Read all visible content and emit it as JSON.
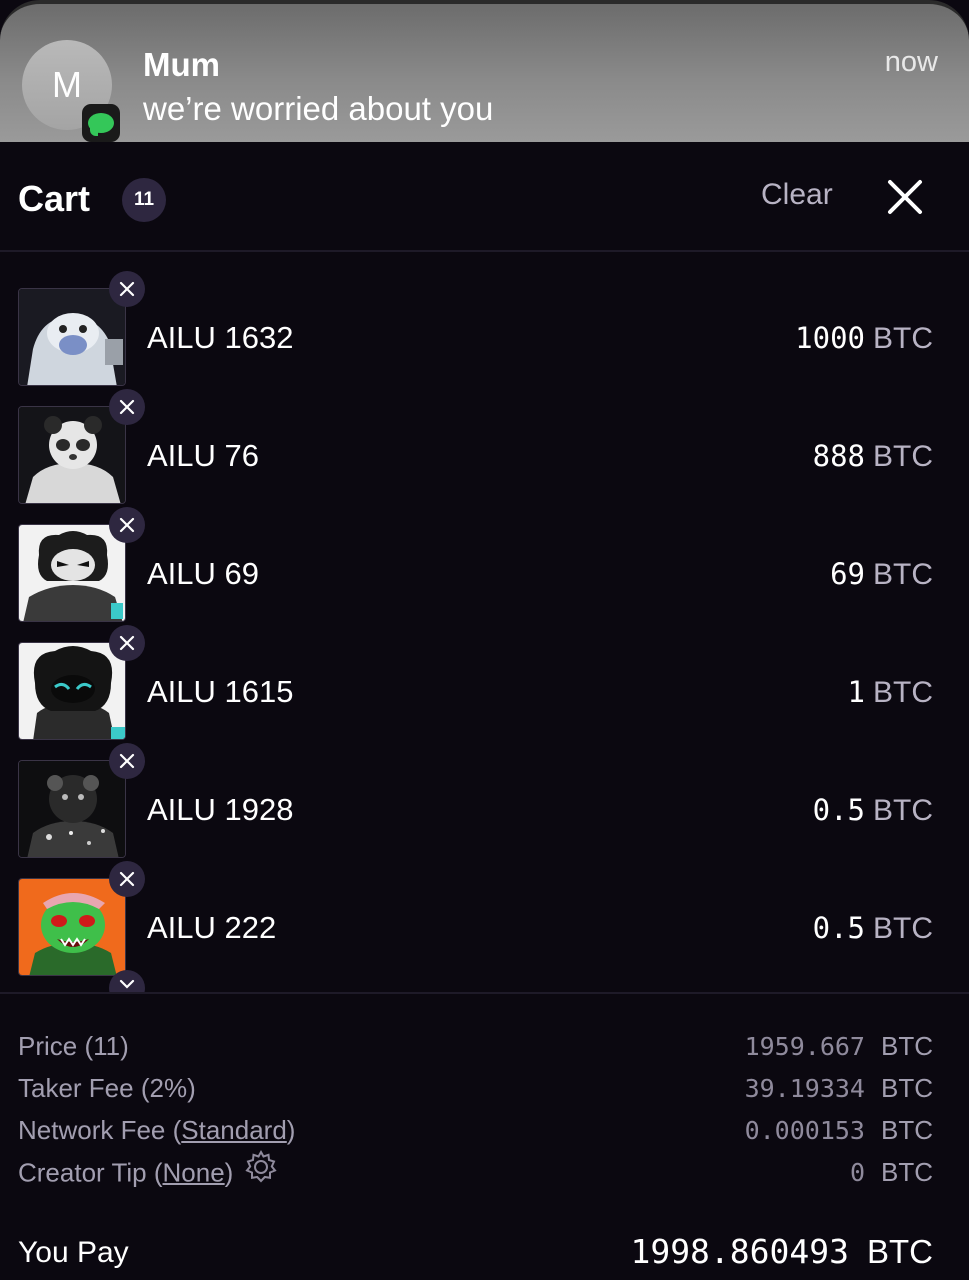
{
  "notification": {
    "avatar_letter": "M",
    "sender": "Mum",
    "message": "we’re worried about you",
    "time": "now"
  },
  "cart": {
    "title": "Cart",
    "count": "11",
    "clear_label": "Clear",
    "close_icon": "close-icon"
  },
  "items": [
    {
      "name": "AILU 1632",
      "amount": "1000",
      "currency": "BTC",
      "thumb_bg": "#1a1a22",
      "thumb_art": "yeti"
    },
    {
      "name": "AILU 76",
      "amount": "888",
      "currency": "BTC",
      "thumb_bg": "#141418",
      "thumb_art": "panda"
    },
    {
      "name": "AILU 69",
      "amount": "69",
      "currency": "BTC",
      "thumb_bg": "#f2f2f2",
      "thumb_art": "panda-angry"
    },
    {
      "name": "AILU 1615",
      "amount": "1",
      "currency": "BTC",
      "thumb_bg": "#f2f2f2",
      "thumb_art": "dark-mask"
    },
    {
      "name": "AILU 1928",
      "amount": "0.5",
      "currency": "BTC",
      "thumb_bg": "#0e0e10",
      "thumb_art": "noise"
    },
    {
      "name": "AILU 222",
      "amount": "0.5",
      "currency": "BTC",
      "thumb_bg": "#f06a1c",
      "thumb_art": "green-monster"
    }
  ],
  "summary": {
    "price_label": "Price (11)",
    "price_value": "1959.667",
    "taker_fee_label": "Taker Fee (2%)",
    "taker_fee_value": "39.19334",
    "network_fee_prefix": "Network Fee (",
    "network_fee_link": "Standard",
    "network_fee_suffix": ")",
    "network_fee_value": "0.000153",
    "creator_tip_prefix": "Creator Tip (",
    "creator_tip_link": "None",
    "creator_tip_suffix": ")",
    "creator_tip_value": "0",
    "currency": "BTC",
    "you_pay_label": "You Pay",
    "you_pay_value": "1998.860493",
    "you_pay_currency": "BTC"
  },
  "colors": {
    "background": "#0b0810",
    "badge": "#2e2740",
    "muted_text": "#a29eb0",
    "imessage_green": "#34c759"
  }
}
